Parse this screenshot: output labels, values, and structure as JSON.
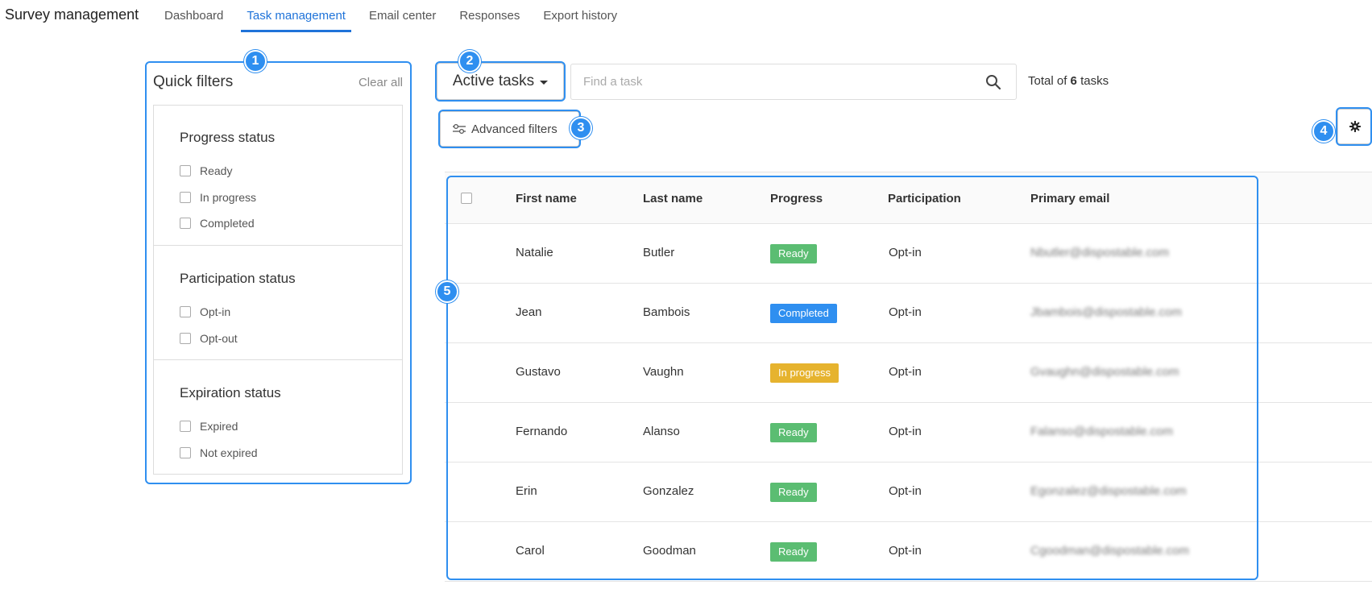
{
  "app": {
    "title": "Survey management"
  },
  "nav": {
    "tabs": [
      {
        "label": "Dashboard",
        "active": false
      },
      {
        "label": "Task management",
        "active": true
      },
      {
        "label": "Email center",
        "active": false
      },
      {
        "label": "Responses",
        "active": false
      },
      {
        "label": "Export history",
        "active": false
      }
    ]
  },
  "markers": [
    "1",
    "2",
    "3",
    "4",
    "5"
  ],
  "quick_filters": {
    "title": "Quick filters",
    "clear_label": "Clear all",
    "groups": [
      {
        "title": "Progress status",
        "options": [
          "Ready",
          "In progress",
          "Completed"
        ]
      },
      {
        "title": "Participation status",
        "options": [
          "Opt-in",
          "Opt-out"
        ]
      },
      {
        "title": "Expiration status",
        "options": [
          "Expired",
          "Not expired"
        ]
      }
    ]
  },
  "toolbar": {
    "view_label": "Active tasks",
    "search_placeholder": "Find a task",
    "total_prefix": "Total of",
    "total_count": "6",
    "total_suffix": "tasks",
    "advanced_filters_label": "Advanced filters"
  },
  "table": {
    "columns": [
      "First name",
      "Last name",
      "Progress",
      "Participation",
      "Primary email"
    ],
    "rows": [
      {
        "first": "Natalie",
        "last": "Butler",
        "progress": "Ready",
        "participation": "Opt-in",
        "email": "Nbutler@dispostable.com"
      },
      {
        "first": "Jean",
        "last": "Bambois",
        "progress": "Completed",
        "participation": "Opt-in",
        "email": "Jbambois@dispostable.com"
      },
      {
        "first": "Gustavo",
        "last": "Vaughn",
        "progress": "In progress",
        "participation": "Opt-in",
        "email": "Gvaughn@dispostable.com"
      },
      {
        "first": "Fernando",
        "last": "Alanso",
        "progress": "Ready",
        "participation": "Opt-in",
        "email": "Falanso@dispostable.com"
      },
      {
        "first": "Erin",
        "last": "Gonzalez",
        "progress": "Ready",
        "participation": "Opt-in",
        "email": "Egonzalez@dispostable.com"
      },
      {
        "first": "Carol",
        "last": "Goodman",
        "progress": "Ready",
        "participation": "Opt-in",
        "email": "Cgoodman@dispostable.com"
      }
    ]
  },
  "colors": {
    "accent": "#1f73d9",
    "marker": "#2f8ff0",
    "status_ready": "#5bbd72",
    "status_completed": "#2f8ff0",
    "status_in_progress": "#e6b32e"
  }
}
